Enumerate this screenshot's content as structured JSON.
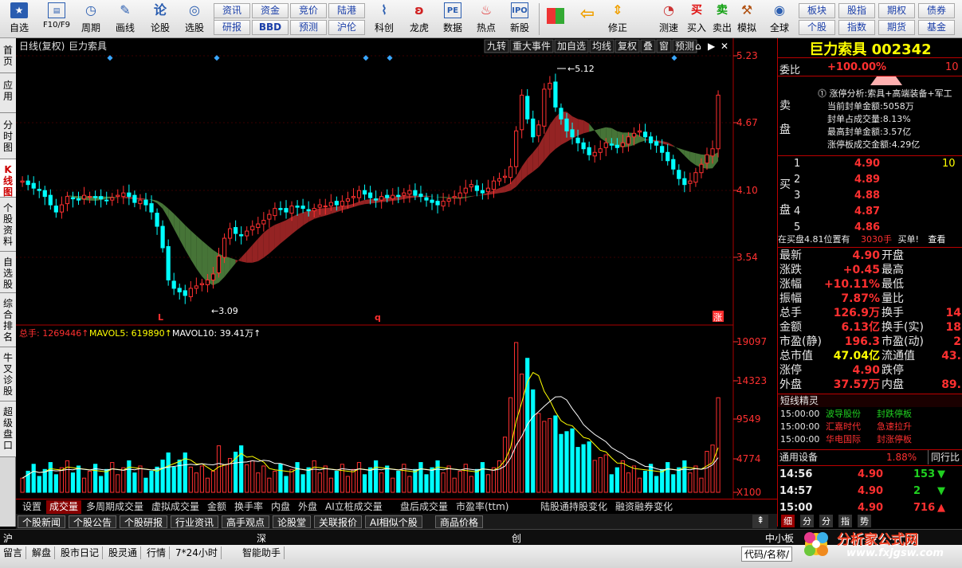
{
  "toolbar": {
    "main_buttons": [
      {
        "label": "自选",
        "icon": "star-icon"
      },
      {
        "label": "F10/F9",
        "icon": "f10-icon"
      },
      {
        "label": "周期",
        "icon": "clock-icon"
      },
      {
        "label": "画线",
        "icon": "pen-icon"
      },
      {
        "label": "论股",
        "icon": "lun-icon"
      },
      {
        "label": "选股",
        "icon": "chart-select-icon"
      }
    ],
    "small_buttons": [
      "资讯",
      "资金",
      "竞价",
      "陆港",
      "研报",
      "BBD",
      "预测",
      "沪伦"
    ],
    "func_buttons": [
      {
        "label": "科创",
        "icon": "kechuang-icon"
      },
      {
        "label": "龙虎",
        "icon": "dragon-icon"
      },
      {
        "label": "数据",
        "icon": "pe-icon"
      },
      {
        "label": "热点",
        "icon": "hot-icon"
      },
      {
        "label": "新股",
        "icon": "ipo-icon"
      }
    ],
    "trade_buttons": [
      {
        "label": "",
        "icon": "windows-icon"
      },
      {
        "label": "",
        "icon": "back-arrow-icon"
      },
      {
        "label": "修正",
        "icon": "up-down-icon"
      },
      {
        "label": "测速",
        "icon": "speed-icon"
      },
      {
        "label": "买入",
        "icon": "buy-icon",
        "glyph": "买"
      },
      {
        "label": "卖出",
        "icon": "sell-icon",
        "glyph": "卖"
      },
      {
        "label": "模拟",
        "icon": "hammer-icon"
      },
      {
        "label": "全球",
        "icon": "globe-icon"
      }
    ],
    "right_buttons": [
      "板块",
      "股指",
      "期权",
      "债券",
      "个股",
      "指数",
      "期货",
      "基金"
    ]
  },
  "left_tabs": [
    "首页",
    "应用",
    "分时图",
    "K线图",
    "个股资料",
    "自选股",
    "综合排名",
    "牛叉诊股",
    "超级盘口"
  ],
  "chart": {
    "header_left": "日线(复权)",
    "stock_label": "巨力索具",
    "header_buttons": [
      "九转",
      "重大事件",
      "加自选",
      "均线",
      "复权",
      "叠",
      "窗",
      "预测"
    ],
    "price_ticks": [
      "5.23",
      "4.67",
      "4.10",
      "3.54"
    ],
    "high_label": "5.12",
    "low_label": "3.09",
    "volume_header": {
      "total": "总手: 1269446↑",
      "ma5": "MAVOL5: 619890↑",
      "ma10": "MAVOL10: 39.41万↑"
    },
    "volume_ticks": [
      "19097",
      "14323",
      "9549",
      "4774",
      "X100"
    ],
    "markers": [
      "L",
      "q",
      "涨"
    ],
    "colors": {
      "up": "#ff3030",
      "down": "#00ffff",
      "band_up": "#9c2525",
      "band_down": "#4a7a3a",
      "ma10": "#ffffff",
      "ma5": "#ffff00"
    }
  },
  "bottom_tabs": [
    "设置",
    "成交量",
    "多周期成交量",
    "虚拟成交量",
    "金额",
    "换手率",
    "内盘",
    "外盘",
    "AI立桩成交量",
    "盘后成交量",
    "市盈率(ttm)",
    "陆股通持股变化",
    "融资融券变化"
  ],
  "news_tabs": [
    "个股新闻",
    "个股公告",
    "个股研报",
    "行业资讯",
    "高手观点",
    "论股堂",
    "关联报价",
    "AI相似个股",
    "商品价格"
  ],
  "right_panel": {
    "title": "巨力索具",
    "code": "002342",
    "weibi_label": "委比",
    "weibi_value": "+100.00%",
    "weibi_right": "10",
    "sell_label": "卖盘",
    "limit_info": [
      "涨停分析:索具+高端装备+军工",
      "当前封单金额:5058万",
      "封单占成交量:8.13%",
      "最高封单金额:3.57亿",
      "涨停板成交金额:4.29亿"
    ],
    "buy_label": "买盘",
    "buy_levels": [
      {
        "n": "1",
        "p": "4.90",
        "v": "10"
      },
      {
        "n": "2",
        "p": "4.89",
        "v": ""
      },
      {
        "n": "3",
        "p": "4.88",
        "v": ""
      },
      {
        "n": "4",
        "p": "4.87",
        "v": ""
      },
      {
        "n": "5",
        "p": "4.86",
        "v": ""
      }
    ],
    "buy_note": "在买盘4.81位置有",
    "buy_note_vol": "3030手",
    "buy_note_tail": "买单!",
    "buy_note_link": "查看",
    "quote": [
      {
        "l": "最新",
        "v": "4.90",
        "l2": "开盘",
        "v2": ""
      },
      {
        "l": "涨跌",
        "v": "+0.45",
        "l2": "最高",
        "v2": ""
      },
      {
        "l": "涨幅",
        "v": "+10.11%",
        "l2": "最低",
        "v2": ""
      },
      {
        "l": "振幅",
        "v": "7.87%",
        "l2": "量比",
        "v2": ""
      },
      {
        "l": "总手",
        "v": "126.9万",
        "l2": "换手",
        "v2": "14"
      },
      {
        "l": "金额",
        "v": "6.13亿",
        "l2": "换手(实)",
        "v2": "18"
      },
      {
        "l": "市盈(静)",
        "v": "196.3",
        "l2": "市盈(动)",
        "v2": "2"
      },
      {
        "l": "总市值",
        "v": "47.04亿",
        "l2": "流通值",
        "v2": "43."
      },
      {
        "l": "涨停",
        "v": "4.90",
        "l2": "跌停",
        "v2": ""
      },
      {
        "l": "外盘",
        "v": "37.57万",
        "l2": "内盘",
        "v2": "89."
      }
    ],
    "short_title": "短线精灵",
    "short_list": [
      {
        "t": "15:00:00",
        "n": "波导股份",
        "e": "封跌停板",
        "c": "grn"
      },
      {
        "t": "15:00:00",
        "n": "汇嘉时代",
        "e": "急速拉升",
        "c": "red"
      },
      {
        "t": "15:00:00",
        "n": "华电国际",
        "e": "封涨停板",
        "c": "red"
      }
    ],
    "industry": "通用设备",
    "industry_pct": "1.88%",
    "industry_right": "同行比",
    "ticks": [
      {
        "t": "14:56",
        "p": "4.90",
        "v": "153",
        "d": "down"
      },
      {
        "t": "14:57",
        "p": "4.90",
        "v": "2",
        "d": "down"
      },
      {
        "t": "15:00",
        "p": "4.90",
        "v": "716",
        "d": "up"
      }
    ],
    "bottom_tabs": [
      "细",
      "分",
      "分",
      "指",
      "势"
    ]
  },
  "index_bar": {
    "items": [
      "沪",
      "深",
      "创"
    ],
    "right": "中小板"
  },
  "status_bar": {
    "items": [
      "留言",
      "解盘",
      "股市日记",
      "股灵通",
      "行情",
      "7*24小时",
      "智能助手"
    ],
    "right": "代码/名称/"
  },
  "watermark": {
    "text": "分析家公式网",
    "url": "www.fxjgsw.com"
  }
}
